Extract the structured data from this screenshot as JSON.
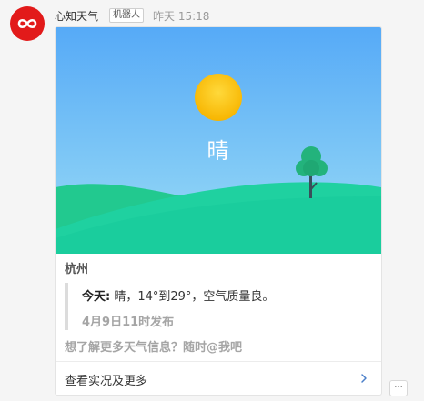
{
  "message": {
    "sender": "心知天气",
    "badge": "机器人",
    "time": "昨天 15:18"
  },
  "card": {
    "weather": "晴",
    "city": "杭州",
    "today_label": "今天:",
    "today_text": " 晴，14°到29°，空气质量良。",
    "published": "4月9日11时发布",
    "promo": "想了解更多天气信息？随时@我吧",
    "more_link": "查看实况及更多"
  },
  "colors": {
    "avatar": "#e21a1a",
    "sky_top": "#56aaf7",
    "sky_bottom": "#8fd6f7",
    "hill_back": "#2ad19a",
    "hill_front": "#1dc99a",
    "sun": "#fcc419",
    "tree": "#20b27a"
  },
  "icons": {
    "avatar": "infinity-logo-icon",
    "chevron": "chevron-right-icon",
    "more": "ellipsis-icon"
  }
}
